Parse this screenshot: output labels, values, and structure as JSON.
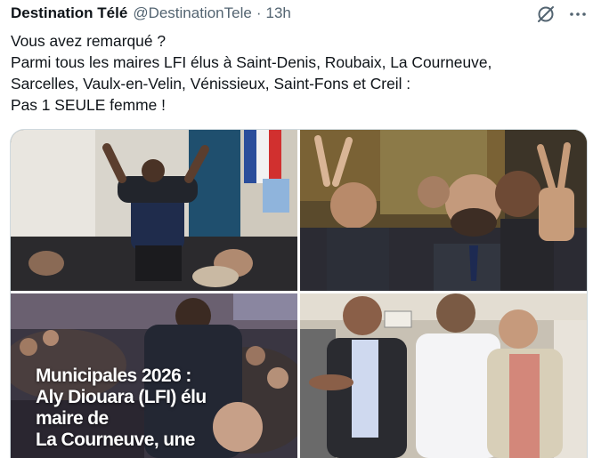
{
  "tweet": {
    "author_name": "Destination Télé",
    "handle": "@DestinationTele",
    "separator": "·",
    "time": "13h",
    "text_lines": [
      "Vous avez remarqué ?",
      "Parmi tous les maires LFI élus à Saint-Denis, Roubaix, La Courneuve,",
      "Sarcelles, Vaulx-en-Velin, Vénissieux, Saint-Fons et Creil :",
      "Pas 1 SEULE femme !"
    ],
    "icons": [
      "grok-icon",
      "more-icon"
    ],
    "media": {
      "photo3_caption_lines": [
        "Municipales 2026 :",
        "Aly Diouara (LFI) élu",
        "maire de",
        "La Courneuve, une"
      ]
    }
  },
  "colors": {
    "text": "#0f1419",
    "secondary": "#536471",
    "border": "#cfd9de"
  }
}
